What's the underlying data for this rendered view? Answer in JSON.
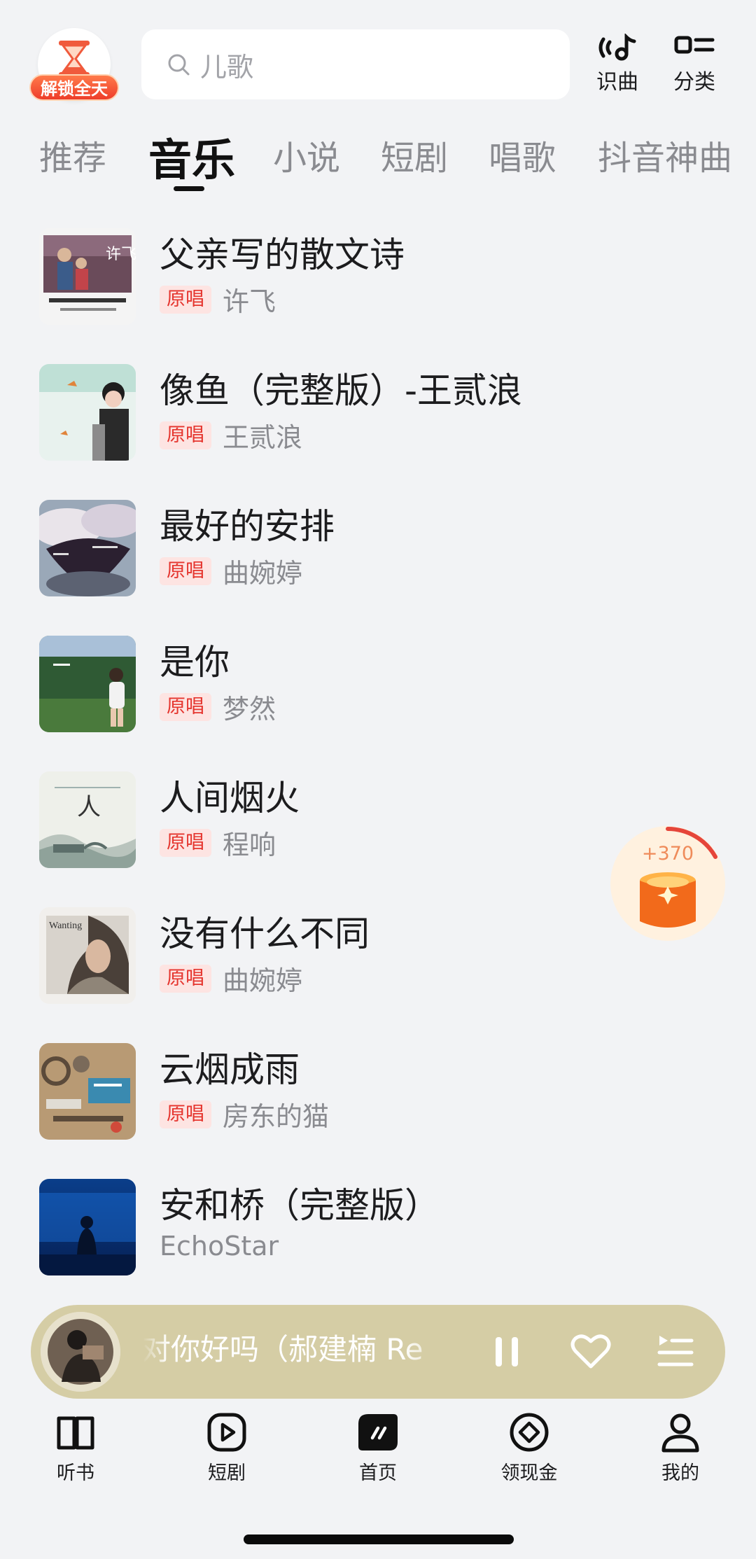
{
  "header": {
    "badge_label": "解锁全天",
    "search_placeholder": "儿歌",
    "recognize_label": "识曲",
    "category_label": "分类"
  },
  "tabs": [
    {
      "label": "推荐",
      "active": false
    },
    {
      "label": "音乐",
      "active": true
    },
    {
      "label": "小说",
      "active": false
    },
    {
      "label": "短剧",
      "active": false
    },
    {
      "label": "唱歌",
      "active": false
    },
    {
      "label": "抖音神曲",
      "active": false
    }
  ],
  "songs": [
    {
      "title": "父亲写的散文诗",
      "tag": "原唱",
      "artist": "许飞",
      "cover": "family-photo-cover"
    },
    {
      "title": "像鱼（完整版）-王贰浪",
      "tag": "原唱",
      "artist": "王贰浪",
      "cover": "girl-portrait-cover"
    },
    {
      "title": "最好的安排",
      "tag": "原唱",
      "artist": "曲婉婷",
      "cover": "dark-clouds-cover"
    },
    {
      "title": "是你",
      "tag": "原唱",
      "artist": "梦然",
      "cover": "girl-in-field-cover"
    },
    {
      "title": "人间烟火",
      "tag": "原唱",
      "artist": "程响",
      "cover": "ink-landscape-cover"
    },
    {
      "title": "没有什么不同",
      "tag": "原唱",
      "artist": "曲婉婷",
      "cover": "woman-portrait-cover"
    },
    {
      "title": "云烟成雨",
      "tag": "原唱",
      "artist": "房东的猫",
      "cover": "collage-cover"
    },
    {
      "title": "安和桥（完整版）",
      "tag": "",
      "artist": "EchoStar",
      "cover": "blue-silhouette-cover"
    }
  ],
  "reward": {
    "amount": "+370",
    "progress": 0.25
  },
  "player": {
    "now_playing": "对你好吗（郝建楠 Re",
    "state": "playing"
  },
  "bottom_nav": [
    {
      "label": "听书",
      "icon": "book-icon"
    },
    {
      "label": "短剧",
      "icon": "play-square-icon"
    },
    {
      "label": "首页",
      "icon": "home-logo-icon",
      "active": true
    },
    {
      "label": "领现金",
      "icon": "coin-icon"
    },
    {
      "label": "我的",
      "icon": "profile-icon"
    }
  ],
  "colors": {
    "background": "#f2f3f5",
    "tag_text": "#e5352e",
    "tag_bg": "#fde4e2",
    "player_bg": "#d5cda5",
    "badge": "#ee3d2a"
  }
}
